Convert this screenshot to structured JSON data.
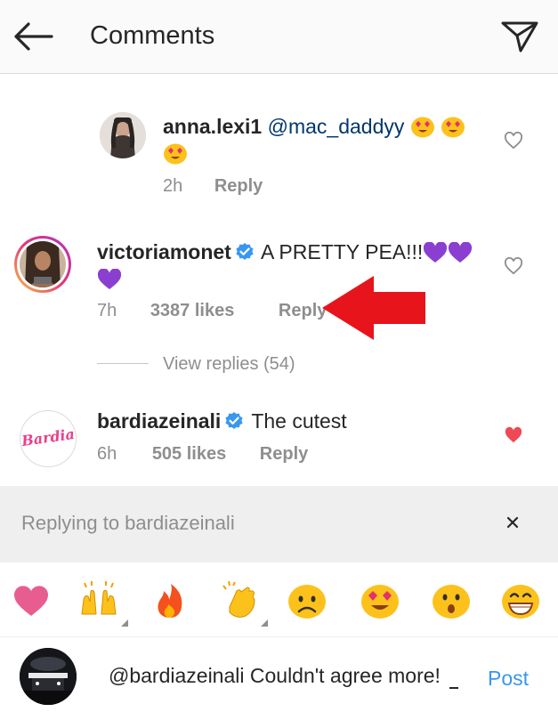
{
  "header": {
    "title": "Comments",
    "back_icon": "arrow-left-icon",
    "send_icon": "paper-plane-icon"
  },
  "comments": [
    {
      "username": "anna.lexi1",
      "mention": "@mac_daddyy",
      "text": "",
      "emojis": [
        "heart-eyes-emoji",
        "heart-eyes-emoji",
        "heart-eyes-emoji"
      ],
      "time": "2h",
      "likes": "",
      "reply_label": "Reply",
      "liked": false
    },
    {
      "username": "victoriamonet",
      "verified": true,
      "text": "A PRETTY PEA!!!",
      "emojis": [
        "purple-heart-emoji",
        "purple-heart-emoji",
        "purple-heart-emoji"
      ],
      "time": "7h",
      "likes": "3387 likes",
      "reply_label": "Reply",
      "liked": false,
      "view_replies": "View replies (54)"
    },
    {
      "username": "bardiazeinali",
      "verified": true,
      "text": "The cutest",
      "avatar_text": "Bardia",
      "time": "6h",
      "likes": "505 likes",
      "reply_label": "Reply",
      "liked": true
    }
  ],
  "reply_bar": {
    "text": "Replying to bardiazeinali",
    "close_label": "×"
  },
  "emoji_bar": [
    "heart",
    "raised-hands",
    "fire",
    "clapping-hands",
    "frowning-face",
    "heart-eyes",
    "astonished-face",
    "grinning-face"
  ],
  "composer": {
    "input_value": "@bardiazeinali Couldn't agree more!",
    "post_label": "Post"
  },
  "colors": {
    "accent": "#3897f0",
    "liked": "#ed4956",
    "annotation_arrow": "#e8141b"
  }
}
